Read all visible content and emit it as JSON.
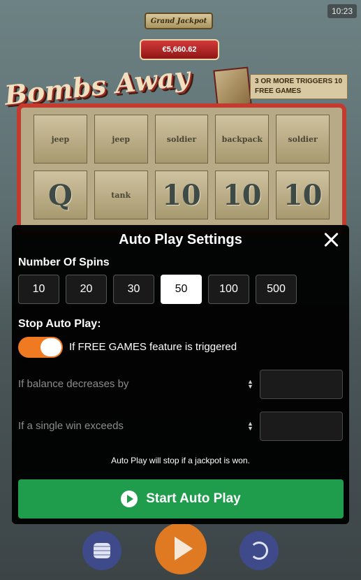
{
  "status_bar": {
    "time": "10:23"
  },
  "game": {
    "title": "Bombs Away",
    "jackpot": {
      "label": "Grand Jackpot",
      "value": "€5,660.62"
    },
    "trigger_banner": "3 OR MORE TRIGGERS 10 FREE GAMES",
    "reels": [
      [
        "jeep",
        "jeep",
        "soldier",
        "backpack",
        "soldier"
      ],
      [
        "Q",
        "tank",
        "10",
        "10",
        "10"
      ]
    ]
  },
  "modal": {
    "title": "Auto Play Settings",
    "spins_label": "Number Of Spins",
    "spin_options": [
      "10",
      "20",
      "30",
      "50",
      "100",
      "500"
    ],
    "selected_spins": "50",
    "stop_label": "Stop Auto Play:",
    "free_games_toggle": {
      "label": "If FREE GAMES feature is triggered",
      "on": true
    },
    "balance_decrease": {
      "label": "If balance decreases by",
      "value": ""
    },
    "single_win": {
      "label": "If a single win exceeds",
      "value": ""
    },
    "jackpot_note": "Auto Play will stop if a jackpot is won.",
    "start_button": "Start Auto Play"
  },
  "colors": {
    "toggle_on": "#f07a22",
    "start_button": "#1f9c4c",
    "spin_button": "#e07a22",
    "side_buttons": "#3e4a8a"
  },
  "icons": {
    "close": "close-icon",
    "play": "play-icon",
    "coins": "coin-stack-icon",
    "refresh": "refresh-icon",
    "stepper": "stepper-arrows-icon"
  }
}
